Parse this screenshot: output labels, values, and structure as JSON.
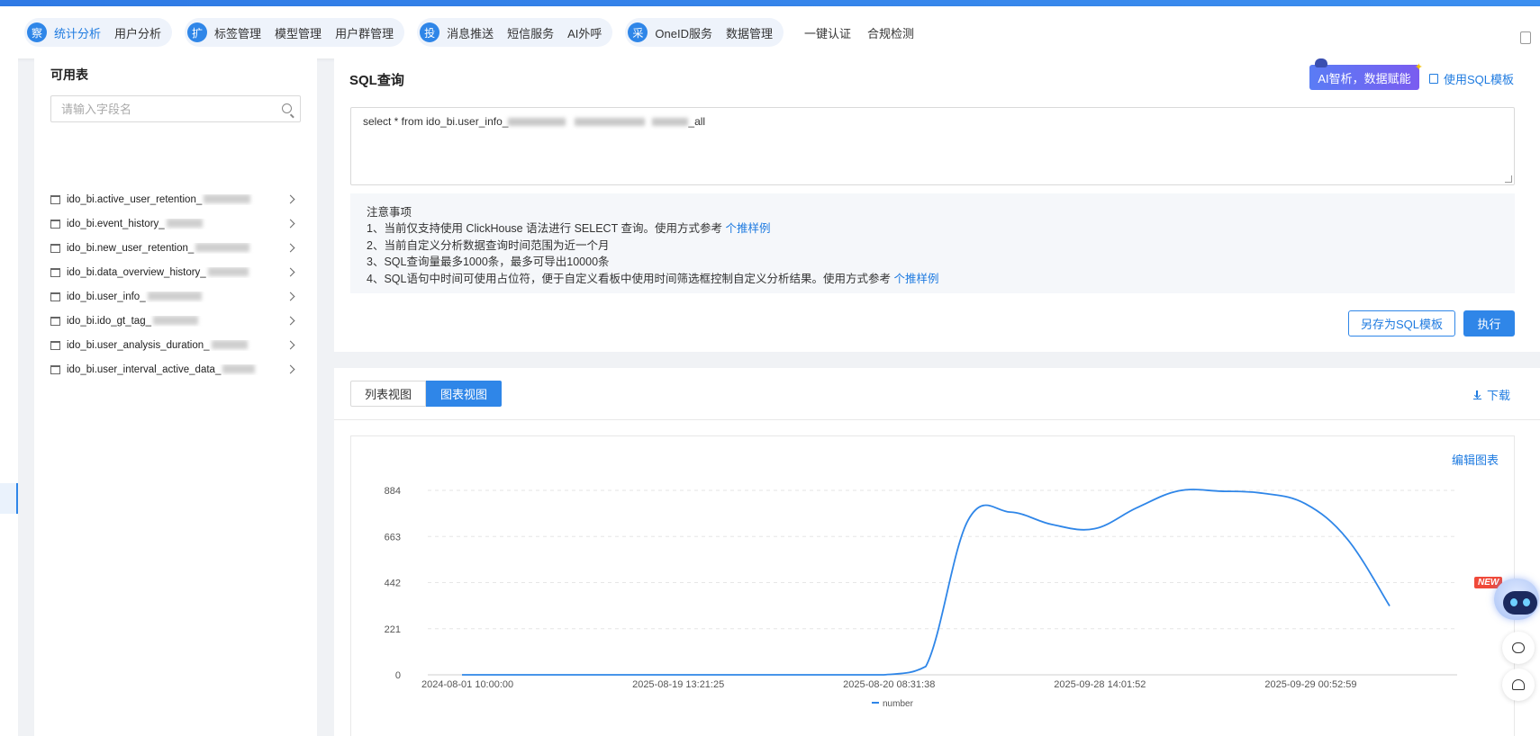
{
  "nav": {
    "groups": [
      {
        "icon": "察",
        "items": [
          "统计分析",
          "用户分析"
        ],
        "active": 0
      },
      {
        "icon": "扩",
        "items": [
          "标签管理",
          "模型管理",
          "用户群管理"
        ],
        "active": -1
      },
      {
        "icon": "投",
        "items": [
          "消息推送",
          "短信服务",
          "AI外呼"
        ],
        "active": -1
      },
      {
        "icon": "采",
        "items": [
          "OneID服务",
          "数据管理"
        ],
        "active": -1
      }
    ],
    "plain": [
      "一键认证",
      "合规检测"
    ]
  },
  "table_panel": {
    "title": "可用表",
    "search_placeholder": "请输入字段名",
    "tables": [
      "ido_bi.active_user_retention_",
      "ido_bi.event_history_",
      "ido_bi.new_user_retention_",
      "ido_bi.data_overview_history_",
      "ido_bi.user_info_",
      "ido_bi.ido_gt_tag_",
      "ido_bi.user_analysis_duration_",
      "ido_bi.user_interval_active_data_"
    ]
  },
  "sql": {
    "title": "SQL查询",
    "ai_button": "AI智析，数据赋能",
    "template_link": "使用SQL模板",
    "query_prefix": "select * from ido_bi.user_info_",
    "query_suffix": "_all",
    "notes_title": "注意事项",
    "note1": "1、当前仅支持使用 ClickHouse 语法进行 SELECT 查询。使用方式参考",
    "note1_link": "个推样例",
    "note2": "2、当前自定义分析数据查询时间范围为近一个月",
    "note3": "3、SQL查询量最多1000条，最多可导出10000条",
    "note4": "4、SQL语句中时间可使用占位符，便于自定义看板中使用时间筛选框控制自定义分析结果。使用方式参考",
    "note4_link": "个推样例",
    "save_button": "另存为SQL模板",
    "run_button": "执行"
  },
  "result": {
    "tabs": [
      "列表视图",
      "图表视图"
    ],
    "active_tab": 1,
    "download": "下载",
    "edit_chart": "编辑图表"
  },
  "chart_data": {
    "type": "line",
    "x": [
      "2024-08-01 10:00:00",
      "",
      "",
      "",
      "",
      "2025-08-19 13:21:25",
      "",
      "",
      "",
      "",
      "2025-08-20 08:31:38",
      "",
      "",
      "",
      "",
      "2025-09-28 14:01:52",
      "",
      "",
      "",
      "",
      "2025-09-29 00:52:59",
      "",
      ""
    ],
    "x_tick_labels": [
      "2024-08-01 10:00:00",
      "2025-08-19 13:21:25",
      "2025-08-20 08:31:38",
      "2025-09-28 14:01:52",
      "2025-09-29 00:52:59"
    ],
    "series": [
      {
        "name": "number",
        "values": [
          0,
          0,
          0,
          0,
          0,
          0,
          0,
          0,
          0,
          0,
          0,
          40,
          740,
          780,
          720,
          700,
          800,
          882,
          880,
          870,
          820,
          650,
          330
        ]
      }
    ],
    "yticks": [
      0,
      221,
      442,
      663,
      884
    ],
    "ylim": [
      0,
      884
    ],
    "grid": true,
    "legend": "bottom",
    "color": "#2f86e8"
  },
  "float": {
    "new_badge": "NEW"
  }
}
